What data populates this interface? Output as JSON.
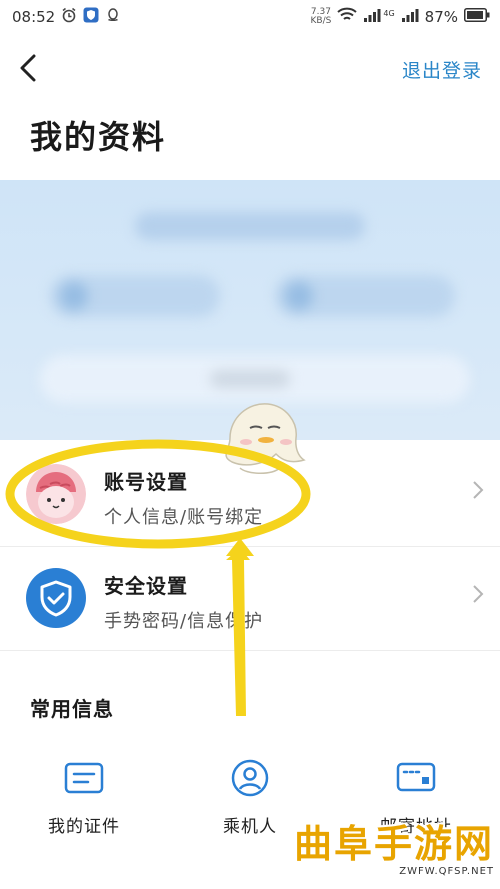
{
  "status_bar": {
    "time": "08:52",
    "net_speed_value": "7.37",
    "net_speed_unit": "KB/S",
    "network": "4G",
    "battery": "87%"
  },
  "header": {
    "title": "我的资料",
    "logout_label": "退出登录"
  },
  "settings": [
    {
      "title": "账号设置",
      "subtitle": "个人信息/账号绑定"
    },
    {
      "title": "安全设置",
      "subtitle": "手势密码/信息保护"
    }
  ],
  "common_info": {
    "title": "常用信息",
    "items": [
      {
        "label": "我的证件",
        "icon": "id-card-icon"
      },
      {
        "label": "乘机人",
        "icon": "passenger-icon"
      },
      {
        "label": "邮寄地址",
        "icon": "address-card-icon"
      }
    ]
  },
  "watermark": {
    "title": "曲阜手游网",
    "url": "ZWFW.QFSP.NET"
  },
  "colors": {
    "accent": "#2a86c8",
    "shield": "#2a7fd4",
    "annotation": "#f5d31c"
  }
}
